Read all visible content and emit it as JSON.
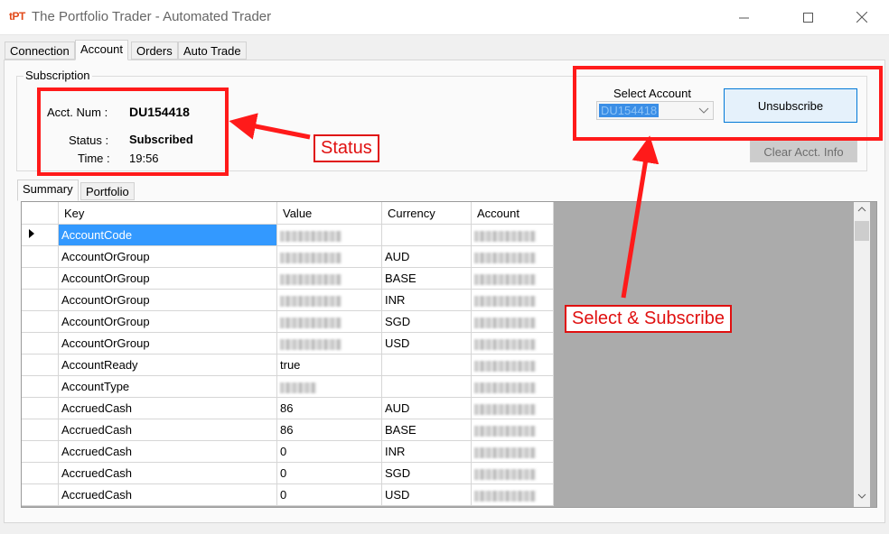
{
  "window": {
    "icon_text": "tPT",
    "title": "The Portfolio Trader - Automated Trader"
  },
  "tabs": [
    "Connection",
    "Account",
    "Orders",
    "Auto Trade"
  ],
  "subscription": {
    "legend": "Subscription",
    "acct_label": "Acct. Num :",
    "acct_value": "DU154418",
    "status_label": "Status :",
    "status_value": "Subscribed",
    "time_label": "Time :",
    "time_value": "19:56",
    "select_label": "Select Account",
    "select_value": "DU154418",
    "unsubscribe_label": "Unsubscribe",
    "clear_label": "Clear Acct. Info"
  },
  "inner_tabs": [
    "Summary",
    "Portfolio"
  ],
  "grid": {
    "columns": [
      "Key",
      "Value",
      "Currency",
      "Account"
    ],
    "rows": [
      {
        "key": "AccountCode",
        "value": "",
        "currency": ""
      },
      {
        "key": "AccountOrGroup",
        "value": "",
        "currency": "AUD"
      },
      {
        "key": "AccountOrGroup",
        "value": "",
        "currency": "BASE"
      },
      {
        "key": "AccountOrGroup",
        "value": "",
        "currency": "INR"
      },
      {
        "key": "AccountOrGroup",
        "value": "",
        "currency": "SGD"
      },
      {
        "key": "AccountOrGroup",
        "value": "",
        "currency": "USD"
      },
      {
        "key": "AccountReady",
        "value": "true",
        "currency": ""
      },
      {
        "key": "AccountType",
        "value": "",
        "currency": ""
      },
      {
        "key": "AccruedCash",
        "value": "86",
        "currency": "AUD"
      },
      {
        "key": "AccruedCash",
        "value": "86",
        "currency": "BASE"
      },
      {
        "key": "AccruedCash",
        "value": "0",
        "currency": "INR"
      },
      {
        "key": "AccruedCash",
        "value": "0",
        "currency": "SGD"
      },
      {
        "key": "AccruedCash",
        "value": "0",
        "currency": "USD"
      }
    ]
  },
  "annotations": {
    "status": "Status",
    "select_subscribe": "Select & Subscribe",
    "color": "#ff1a1a"
  }
}
